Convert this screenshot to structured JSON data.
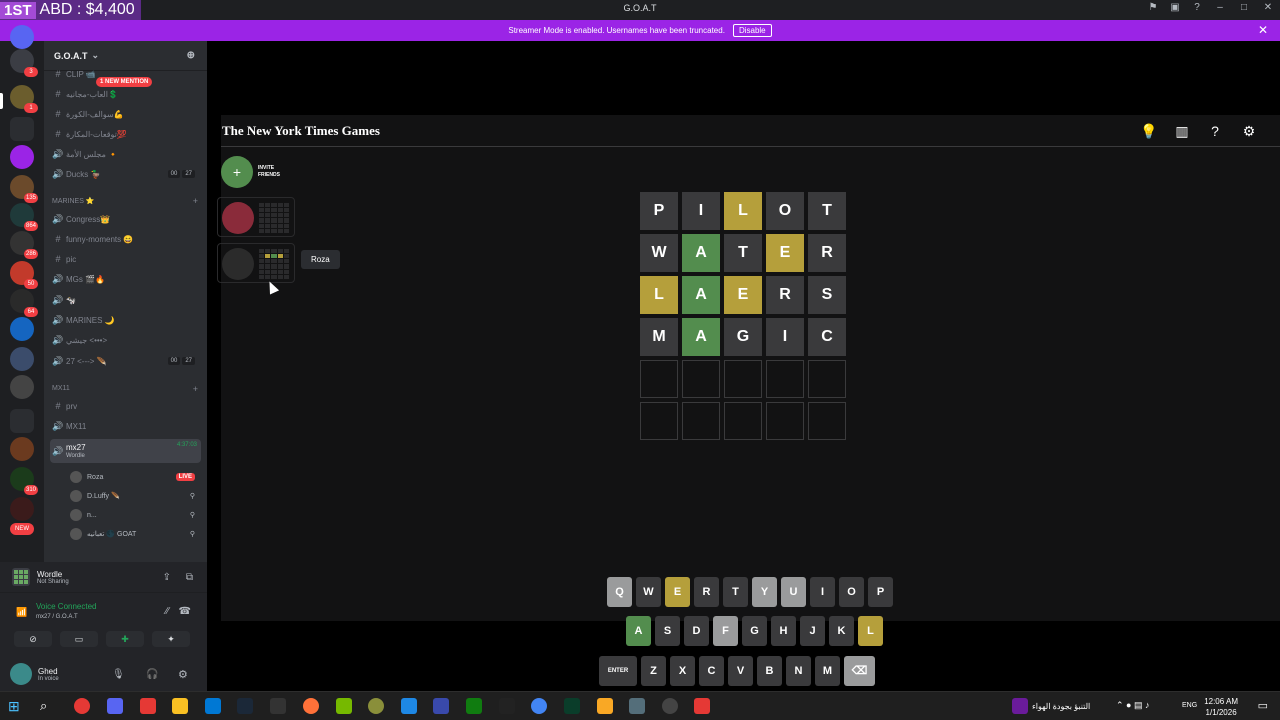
{
  "overlay": {
    "rank": "1ST",
    "text": "ABD : $4,400"
  },
  "window": {
    "title": "G.O.A.T"
  },
  "banner": {
    "message": "Streamer Mode is enabled. Usernames have been truncated.",
    "disable": "Disable"
  },
  "rail": {
    "badges": [
      "3",
      "1",
      "135",
      "864",
      "286",
      "50",
      "64",
      "310",
      "NEW"
    ]
  },
  "guild": {
    "name": "G.O.A.T",
    "new_mention": "1 NEW MENTION"
  },
  "channels": [
    {
      "name": "CLIP 📹",
      "type": "text"
    },
    {
      "name": "العاب-مجانيه💲",
      "type": "text"
    },
    {
      "name": "سوالف-الكورة💪",
      "type": "text"
    },
    {
      "name": "توقعات-المكارة💯",
      "type": "text"
    },
    {
      "name": "مجلس الأمة 🔸",
      "type": "voice"
    },
    {
      "name": "Ducks 🦆",
      "type": "voice",
      "c1": "00",
      "c2": "27"
    }
  ],
  "cat_marines": "MARINES ⭐",
  "marines": [
    {
      "name": "Congress👑",
      "type": "voice"
    },
    {
      "name": "funny-moments 😄",
      "type": "text"
    },
    {
      "name": "pic",
      "type": "text"
    },
    {
      "name": "MGs 🎬🔥",
      "type": "voice"
    },
    {
      "name": "🐄",
      "type": "voice"
    },
    {
      "name": "MARINES 🌙",
      "type": "voice"
    },
    {
      "name": "جيشي <•••>",
      "type": "voice"
    },
    {
      "name": "27 <---> 🪶",
      "type": "voice",
      "c1": "00",
      "c2": "27"
    }
  ],
  "cat_mx": "MX11",
  "mx": [
    {
      "name": "prv",
      "type": "text"
    },
    {
      "name": "MX11",
      "type": "voice"
    },
    {
      "name": "mx27",
      "type": "voice",
      "time": "4:37:03",
      "sub": "Wordle"
    }
  ],
  "voice_users": [
    {
      "name": "Roza",
      "live": "LIVE"
    },
    {
      "name": "D.Luffy 🪶"
    },
    {
      "name": "n..."
    },
    {
      "name": "تعبانيه 🌑 GOAT"
    }
  ],
  "activity": {
    "title": "Wordle",
    "sub": "Not Sharing"
  },
  "voice": {
    "status": "Voice Connected",
    "channel": "mx27 / G.O.A.T"
  },
  "user": {
    "name": "Ghed",
    "status": "In voice"
  },
  "nyt": {
    "logo": "The New York Times Games"
  },
  "invite": {
    "line1": "INVITE",
    "line2": "FRIENDS"
  },
  "tooltip": "Roza",
  "board": [
    [
      [
        "P",
        "absent"
      ],
      [
        "I",
        "absent"
      ],
      [
        "L",
        "present"
      ],
      [
        "O",
        "absent"
      ],
      [
        "T",
        "absent"
      ]
    ],
    [
      [
        "W",
        "absent"
      ],
      [
        "A",
        "correct"
      ],
      [
        "T",
        "absent"
      ],
      [
        "E",
        "present"
      ],
      [
        "R",
        "absent"
      ]
    ],
    [
      [
        "L",
        "present"
      ],
      [
        "A",
        "correct"
      ],
      [
        "E",
        "present"
      ],
      [
        "R",
        "absent"
      ],
      [
        "S",
        "absent"
      ]
    ],
    [
      [
        "M",
        "absent"
      ],
      [
        "A",
        "correct"
      ],
      [
        "G",
        "absent"
      ],
      [
        "I",
        "absent"
      ],
      [
        "C",
        "absent"
      ]
    ],
    [
      [
        "",
        "empty"
      ],
      [
        "",
        "empty"
      ],
      [
        "",
        "empty"
      ],
      [
        "",
        "empty"
      ],
      [
        "",
        "empty"
      ]
    ],
    [
      [
        "",
        "empty"
      ],
      [
        "",
        "empty"
      ],
      [
        "",
        "empty"
      ],
      [
        "",
        "empty"
      ],
      [
        "",
        "empty"
      ]
    ]
  ],
  "keyboard": [
    [
      [
        "Q",
        "lite"
      ],
      [
        "W",
        "absent"
      ],
      [
        "E",
        "present"
      ],
      [
        "R",
        "absent"
      ],
      [
        "T",
        "absent"
      ],
      [
        "Y",
        "lite"
      ],
      [
        "U",
        "lite"
      ],
      [
        "I",
        "absent"
      ],
      [
        "O",
        "absent"
      ],
      [
        "P",
        "absent"
      ]
    ],
    [
      [
        "A",
        "correct"
      ],
      [
        "S",
        "absent"
      ],
      [
        "D",
        "absent"
      ],
      [
        "F",
        "lite"
      ],
      [
        "G",
        "absent"
      ],
      [
        "H",
        "absent"
      ],
      [
        "J",
        "absent"
      ],
      [
        "K",
        "absent"
      ],
      [
        "L",
        "present"
      ]
    ],
    [
      [
        "ENTER",
        "absent"
      ],
      [
        "Z",
        "absent"
      ],
      [
        "X",
        "absent"
      ],
      [
        "C",
        "absent"
      ],
      [
        "V",
        "absent"
      ],
      [
        "B",
        "absent"
      ],
      [
        "N",
        "absent"
      ],
      [
        "M",
        "absent"
      ],
      [
        "⌫",
        "lite"
      ]
    ]
  ],
  "taskbar": {
    "weather": "التنبؤ بجودة الهواء",
    "lang": "ENG",
    "time": "12:06 AM",
    "date": "1/1/2026"
  },
  "colors": {
    "correct": "#538d4e",
    "present": "#b59f3b",
    "absent": "#3a3a3c",
    "banner": "#9b24e6"
  }
}
